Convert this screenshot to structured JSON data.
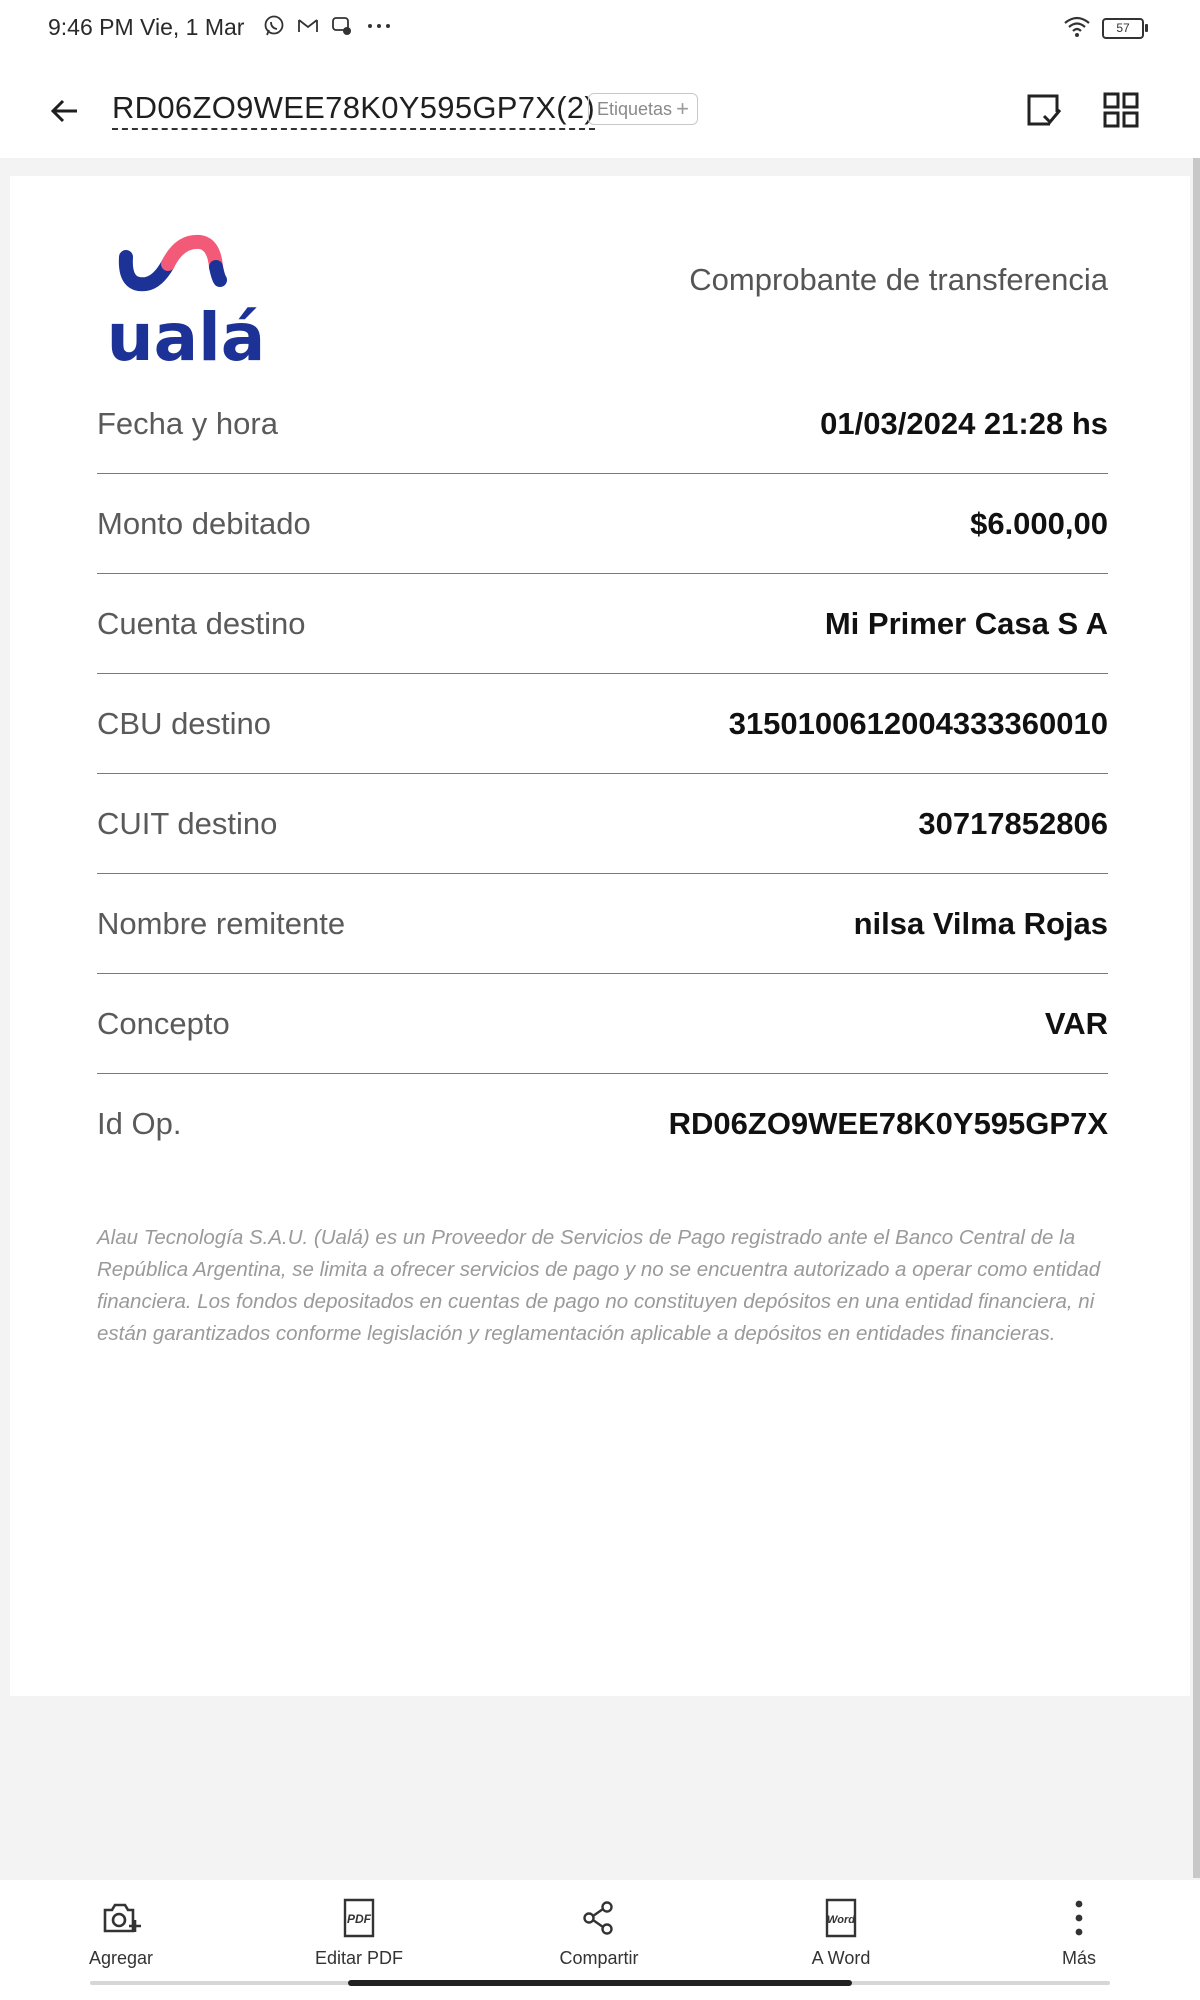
{
  "status_bar": {
    "time": "9:46 PM Vie, 1 Mar",
    "icons": [
      "whatsapp-icon",
      "gmail-icon",
      "messenger-icon",
      "more-dots-icon"
    ],
    "right_icons": [
      "wifi-icon",
      "battery-icon"
    ],
    "battery_level": "57"
  },
  "app_bar": {
    "title": "RD06ZO9WEE78K0Y595GP7X(2)",
    "tags_label": "Etiquetas",
    "tags_plus": "+",
    "icons": [
      "back-arrow-icon",
      "check-document-icon",
      "grid-view-icon"
    ]
  },
  "document": {
    "logo_text": "ualá",
    "heading": "Comprobante de transferencia",
    "rows": [
      {
        "label": "Fecha y hora",
        "value": "01/03/2024 21:28 hs"
      },
      {
        "label": "Monto debitado",
        "value": "$6.000,00"
      },
      {
        "label": "Cuenta destino",
        "value": "Mi Primer Casa S A"
      },
      {
        "label": "CBU destino",
        "value": "3150100612004333360010"
      },
      {
        "label": "CUIT destino",
        "value": "30717852806"
      },
      {
        "label": "Nombre remitente",
        "value": "nilsa Vilma Rojas"
      },
      {
        "label": "Concepto",
        "value": "VAR"
      },
      {
        "label": "Id Op.",
        "value": "RD06ZO9WEE78K0Y595GP7X"
      }
    ],
    "disclaimer": "Alau Tecnología S.A.U. (Ualá) es un Proveedor de Servicios de Pago registrado ante el Banco Central de la República Argentina, se limita a ofrecer servicios de pago y no se encuentra autorizado a operar como entidad financiera. Los fondos depositados en cuentas de pago no constituyen depósitos en una entidad financiera, ni están garantizados conforme legislación y reglamentación aplicable a depósitos en entidades financieras."
  },
  "toolbar": {
    "items": [
      {
        "label": "Agregar",
        "icon": "add-photo-icon"
      },
      {
        "label": "Editar PDF",
        "icon": "pdf-icon"
      },
      {
        "label": "Compartir",
        "icon": "share-icon"
      },
      {
        "label": "A Word",
        "icon": "word-icon"
      },
      {
        "label": "Más",
        "icon": "more-vertical-icon"
      }
    ],
    "pdf_glyph": "PDF",
    "word_glyph": "Word"
  },
  "colors": {
    "brand_blue": "#1d3296",
    "brand_pink": "#f25a78"
  }
}
